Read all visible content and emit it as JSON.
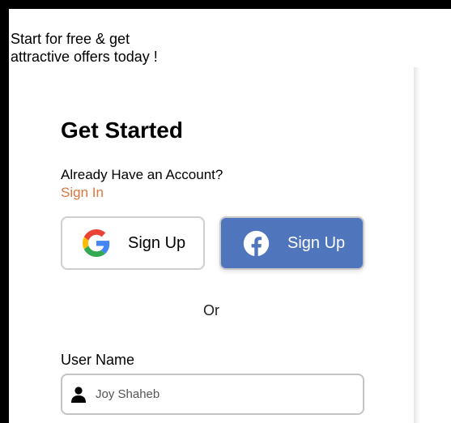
{
  "promo": {
    "line1": "Start for free & get",
    "line2": "attractive offers today !"
  },
  "auth": {
    "title": "Get Started",
    "account_question": "Already Have an Account?",
    "signin_link": "Sign In"
  },
  "social": {
    "google_label": "Sign Up",
    "facebook_label": "Sign Up",
    "google_icon": "google-icon",
    "facebook_icon": "facebook-icon"
  },
  "divider": "Or",
  "form": {
    "username_label": "User Name",
    "username_placeholder": "Joy Shaheb",
    "username_icon": "user-icon"
  },
  "colors": {
    "accent_link": "#e0763c",
    "facebook_blue": "#4f75bd"
  }
}
